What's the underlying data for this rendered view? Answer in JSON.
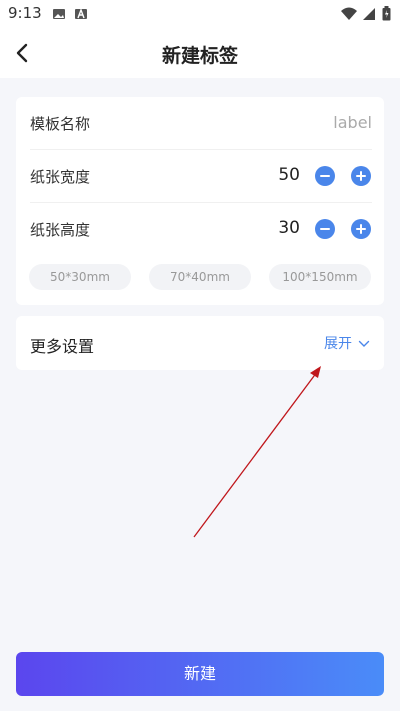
{
  "status_bar": {
    "time": "9:13",
    "icons": [
      "image-icon",
      "text-a-icon",
      "wifi-icon",
      "signal-icon",
      "battery-icon"
    ]
  },
  "header": {
    "title": "新建标签",
    "back_icon": "chevron-left-icon"
  },
  "form": {
    "template_name": {
      "label": "模板名称",
      "placeholder": "label"
    },
    "paper_width": {
      "label": "纸张宽度",
      "value": "50"
    },
    "paper_height": {
      "label": "纸张高度",
      "value": "30"
    },
    "presets": [
      "50*30mm",
      "70*40mm",
      "100*150mm"
    ]
  },
  "more_settings": {
    "label": "更多设置",
    "toggle_label": "展开"
  },
  "footer": {
    "create_label": "新建"
  },
  "colors": {
    "accent": "#4a86ea",
    "gradient_start": "#5b46ee",
    "gradient_end": "#4a8cf8",
    "annotation": "#c0171c"
  }
}
